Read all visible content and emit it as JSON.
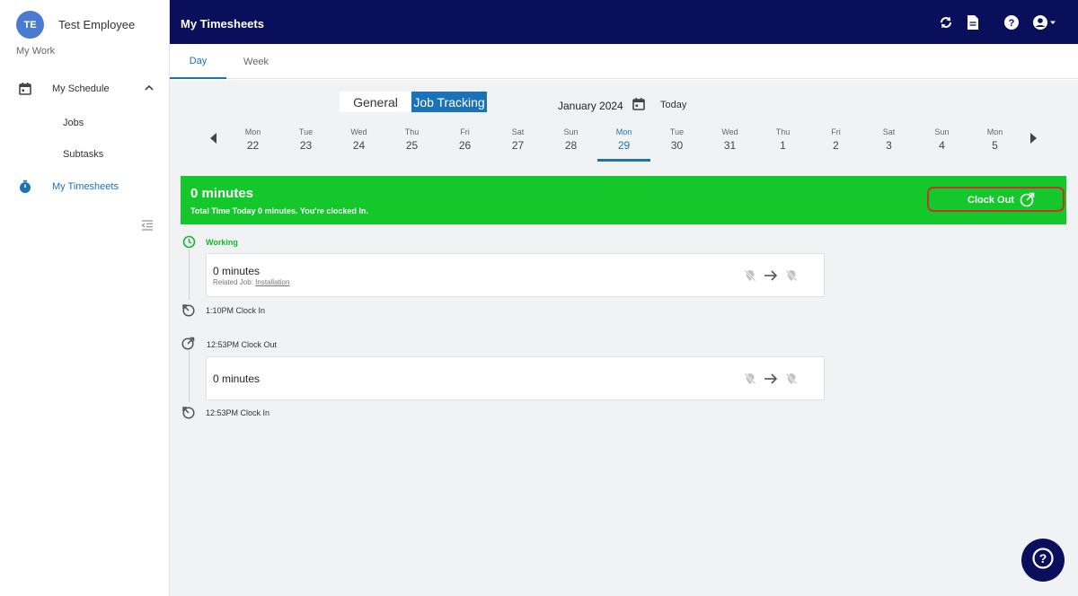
{
  "sidebar": {
    "avatar_initials": "TE",
    "user_name": "Test Employee",
    "section_label": "My Work",
    "items": [
      {
        "label": "My Schedule",
        "icon": "calendar-icon"
      },
      {
        "label": "Jobs"
      },
      {
        "label": "Subtasks"
      },
      {
        "label": "My Timesheets",
        "icon": "stopwatch-icon",
        "active": true
      }
    ]
  },
  "header": {
    "title": "My Timesheets",
    "icons": [
      "refresh-icon",
      "document-icon",
      "help-icon",
      "account-icon"
    ]
  },
  "tabs": [
    {
      "label": "Day",
      "active": true
    },
    {
      "label": "Week"
    }
  ],
  "view_toggle": {
    "general": "General",
    "job_tracking": "Job Tracking",
    "selected": "Job Tracking"
  },
  "date_nav": {
    "month": "January 2024",
    "today": "Today",
    "days": [
      {
        "name": "Mon",
        "date": "22"
      },
      {
        "name": "Tue",
        "date": "23"
      },
      {
        "name": "Wed",
        "date": "24"
      },
      {
        "name": "Thu",
        "date": "25"
      },
      {
        "name": "Fri",
        "date": "26"
      },
      {
        "name": "Sat",
        "date": "27"
      },
      {
        "name": "Sun",
        "date": "28"
      },
      {
        "name": "Mon",
        "date": "29",
        "selected": true
      },
      {
        "name": "Tue",
        "date": "30"
      },
      {
        "name": "Wed",
        "date": "31"
      },
      {
        "name": "Thu",
        "date": "1"
      },
      {
        "name": "Fri",
        "date": "2"
      },
      {
        "name": "Sat",
        "date": "3"
      },
      {
        "name": "Sun",
        "date": "4"
      },
      {
        "name": "Mon",
        "date": "5"
      }
    ]
  },
  "status_banner": {
    "total": "0 minutes",
    "message": "Total Time Today 0 minutes. You're clocked In.",
    "clock_out_label": "Clock Out",
    "color": "#14c82c"
  },
  "timeline": {
    "working_label": "Working",
    "entry1": {
      "duration": "0 minutes",
      "related_prefix": "Related Job: ",
      "related_job": "Installation",
      "clock_in": "1:10PM Clock In"
    },
    "entry2": {
      "clock_out": "12:53PM Clock Out",
      "duration": "0 minutes",
      "clock_in": "12:53PM Clock In"
    }
  },
  "colors": {
    "header_bg": "#0a0f5c",
    "accent": "#1a73b8",
    "working": "#14b82a",
    "highlight_border": "#d02f2f"
  }
}
